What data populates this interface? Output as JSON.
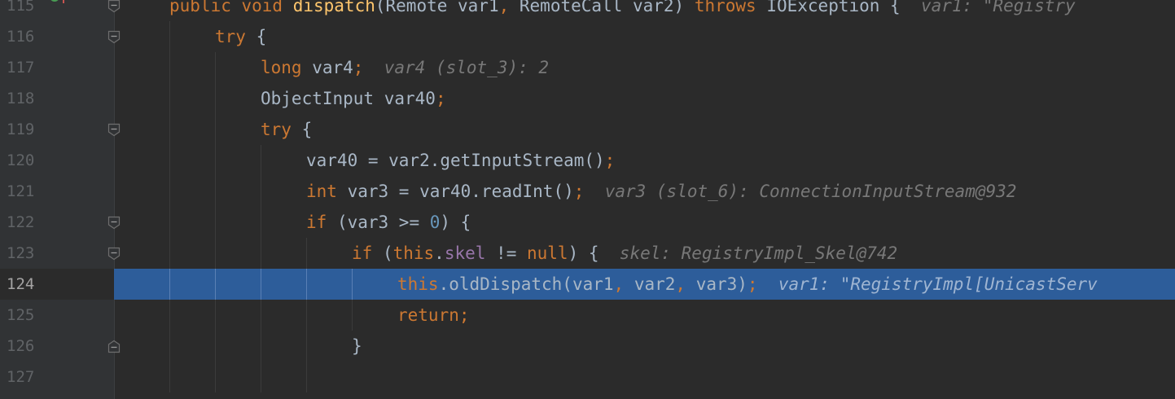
{
  "editor": {
    "lines": [
      {
        "number": "115",
        "indent": 1,
        "tokens": [
          {
            "t": "public void ",
            "c": "kw"
          },
          {
            "t": "dispatch",
            "c": "fn"
          },
          {
            "t": "(Remote var1",
            "c": "plain"
          },
          {
            "t": ", ",
            "c": "semi"
          },
          {
            "t": "RemoteCall var2) ",
            "c": "plain"
          },
          {
            "t": "throws ",
            "c": "kw"
          },
          {
            "t": "IOException {",
            "c": "plain"
          }
        ],
        "hint": "var1: \"Registry"
      },
      {
        "number": "116",
        "indent": 2,
        "tokens": [
          {
            "t": "try ",
            "c": "kw"
          },
          {
            "t": "{",
            "c": "plain"
          }
        ],
        "hint": ""
      },
      {
        "number": "117",
        "indent": 3,
        "tokens": [
          {
            "t": "long ",
            "c": "kw"
          },
          {
            "t": "var4",
            "c": "plain"
          },
          {
            "t": ";",
            "c": "semi"
          }
        ],
        "hint": "var4 (slot_3): 2"
      },
      {
        "number": "118",
        "indent": 3,
        "tokens": [
          {
            "t": "ObjectInput var40",
            "c": "plain"
          },
          {
            "t": ";",
            "c": "semi"
          }
        ],
        "hint": ""
      },
      {
        "number": "119",
        "indent": 3,
        "tokens": [
          {
            "t": "try ",
            "c": "kw"
          },
          {
            "t": "{",
            "c": "plain"
          }
        ],
        "hint": ""
      },
      {
        "number": "120",
        "indent": 4,
        "tokens": [
          {
            "t": "var40 = var2.getInputStream()",
            "c": "plain"
          },
          {
            "t": ";",
            "c": "semi"
          }
        ],
        "hint": ""
      },
      {
        "number": "121",
        "indent": 4,
        "tokens": [
          {
            "t": "int ",
            "c": "kw"
          },
          {
            "t": "var3 = var40.readInt()",
            "c": "plain"
          },
          {
            "t": ";",
            "c": "semi"
          }
        ],
        "hint": "var3 (slot_6): ConnectionInputStream@932"
      },
      {
        "number": "122",
        "indent": 4,
        "tokens": [
          {
            "t": "if ",
            "c": "kw"
          },
          {
            "t": "(var3 >= ",
            "c": "plain"
          },
          {
            "t": "0",
            "c": "num"
          },
          {
            "t": ") {",
            "c": "plain"
          }
        ],
        "hint": ""
      },
      {
        "number": "123",
        "indent": 5,
        "tokens": [
          {
            "t": "if ",
            "c": "kw"
          },
          {
            "t": "(",
            "c": "plain"
          },
          {
            "t": "this",
            "c": "kw"
          },
          {
            "t": ".",
            "c": "plain"
          },
          {
            "t": "skel",
            "c": "field"
          },
          {
            "t": " != ",
            "c": "plain"
          },
          {
            "t": "null",
            "c": "kw"
          },
          {
            "t": ") {",
            "c": "plain"
          }
        ],
        "hint": "skel: RegistryImpl_Skel@742"
      },
      {
        "number": "124",
        "indent": 6,
        "current": true,
        "tokens": [
          {
            "t": "this",
            "c": "kw"
          },
          {
            "t": ".oldDispatch(var1",
            "c": "plain"
          },
          {
            "t": ", ",
            "c": "semi"
          },
          {
            "t": "var2",
            "c": "plain"
          },
          {
            "t": ", ",
            "c": "semi"
          },
          {
            "t": "var3)",
            "c": "plain"
          },
          {
            "t": ";",
            "c": "semi"
          }
        ],
        "hint": "var1: \"RegistryImpl[UnicastServ"
      },
      {
        "number": "125",
        "indent": 6,
        "tokens": [
          {
            "t": "return",
            "c": "kw"
          },
          {
            "t": ";",
            "c": "semi"
          }
        ],
        "hint": ""
      },
      {
        "number": "126",
        "indent": 5,
        "tokens": [
          {
            "t": "}",
            "c": "plain"
          }
        ],
        "hint": ""
      },
      {
        "number": "127",
        "indent": 0,
        "tokens": [],
        "hint": ""
      }
    ],
    "colors": {
      "background": "#2b2b2b",
      "gutter": "#313335",
      "current_line": "#2d5d9a",
      "keyword": "#cc7832",
      "method": "#ffc66d",
      "number": "#6897bb",
      "field": "#9876aa",
      "text": "#a9b7c6",
      "hint": "#787878"
    },
    "icons": {
      "override_marker": "implements-method-icon",
      "fold_open": "fold-open-icon",
      "fold_close": "fold-close-icon"
    }
  }
}
